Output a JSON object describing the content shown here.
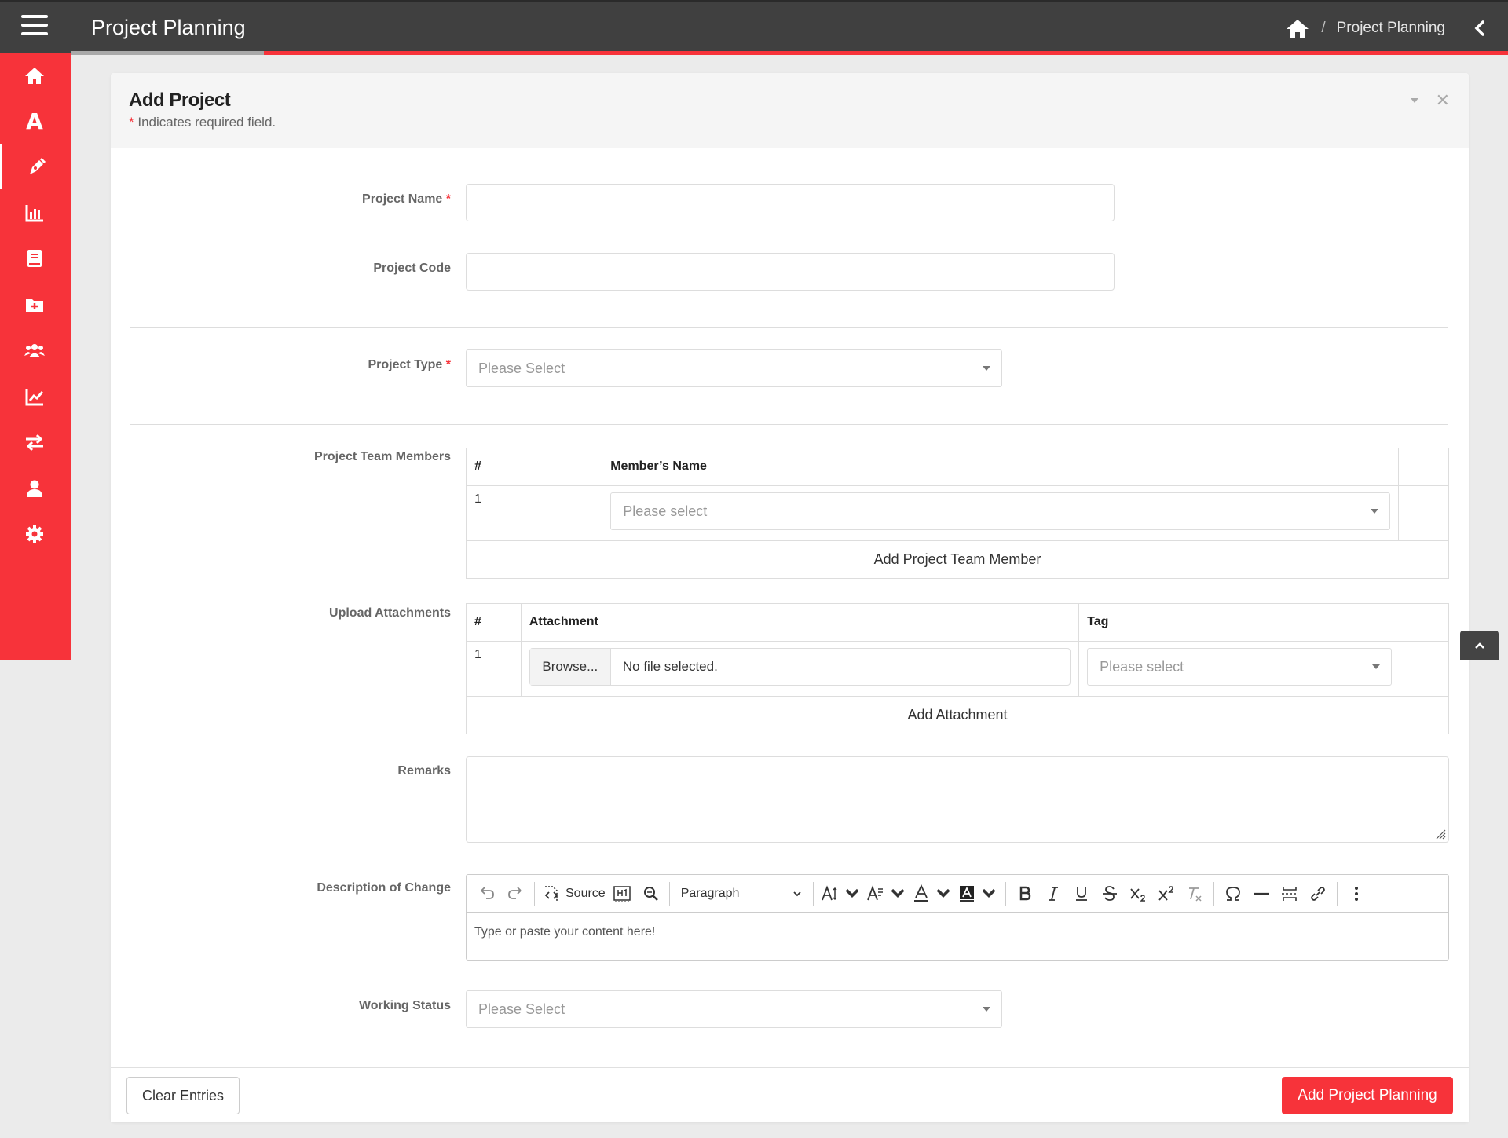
{
  "app": {
    "title": "Project Planning",
    "accent": "#f7333a",
    "topbar_bg": "#404040"
  },
  "breadcrumb": {
    "home_icon": "home-icon",
    "current": "Project Planning",
    "separator": "/"
  },
  "sidebar": {
    "items": [
      {
        "name": "home",
        "icon": "home-icon"
      },
      {
        "name": "font",
        "icon": "A",
        "letter": "A"
      },
      {
        "name": "pen",
        "icon": "pen-icon",
        "active": true
      },
      {
        "name": "bar-chart",
        "icon": "bar-chart-icon"
      },
      {
        "name": "book",
        "icon": "book-icon"
      },
      {
        "name": "folder-plus",
        "icon": "folder-plus-icon"
      },
      {
        "name": "users",
        "icon": "users-icon"
      },
      {
        "name": "line-chart",
        "icon": "line-chart-icon"
      },
      {
        "name": "exchange",
        "icon": "exchange-icon"
      },
      {
        "name": "user",
        "icon": "user-icon"
      },
      {
        "name": "settings",
        "icon": "gear-icon"
      }
    ]
  },
  "form": {
    "title": "Add Project",
    "required_note_star": "*",
    "required_note": " Indicates required field.",
    "required_star": "*",
    "project_name": {
      "label": "Project Name",
      "value": ""
    },
    "project_code": {
      "label": "Project Code",
      "value": ""
    },
    "project_type": {
      "label": "Project Type",
      "placeholder": "Please Select"
    },
    "team_members": {
      "label": "Project Team Members",
      "columns": [
        "#",
        "Member’s Name"
      ],
      "rows": [
        {
          "num": "1",
          "placeholder": "Please select"
        }
      ],
      "add_label": "Add Project Team Member"
    },
    "attachments": {
      "label": "Upload Attachments",
      "columns": [
        "#",
        "Attachment",
        "Tag"
      ],
      "rows": [
        {
          "num": "1",
          "browse": "Browse...",
          "file": "No file selected.",
          "tag_placeholder": "Please select"
        }
      ],
      "add_label": "Add Attachment"
    },
    "remarks": {
      "label": "Remarks",
      "value": ""
    },
    "description": {
      "label": "Description of Change",
      "toolbar": {
        "source": "Source",
        "heading": "Paragraph"
      },
      "placeholder": "Type or paste your content here!"
    },
    "working_status": {
      "label": "Working Status",
      "placeholder": "Please Select"
    }
  },
  "footer": {
    "clear_label": "Clear Entries",
    "submit_label": "Add Project Planning"
  }
}
